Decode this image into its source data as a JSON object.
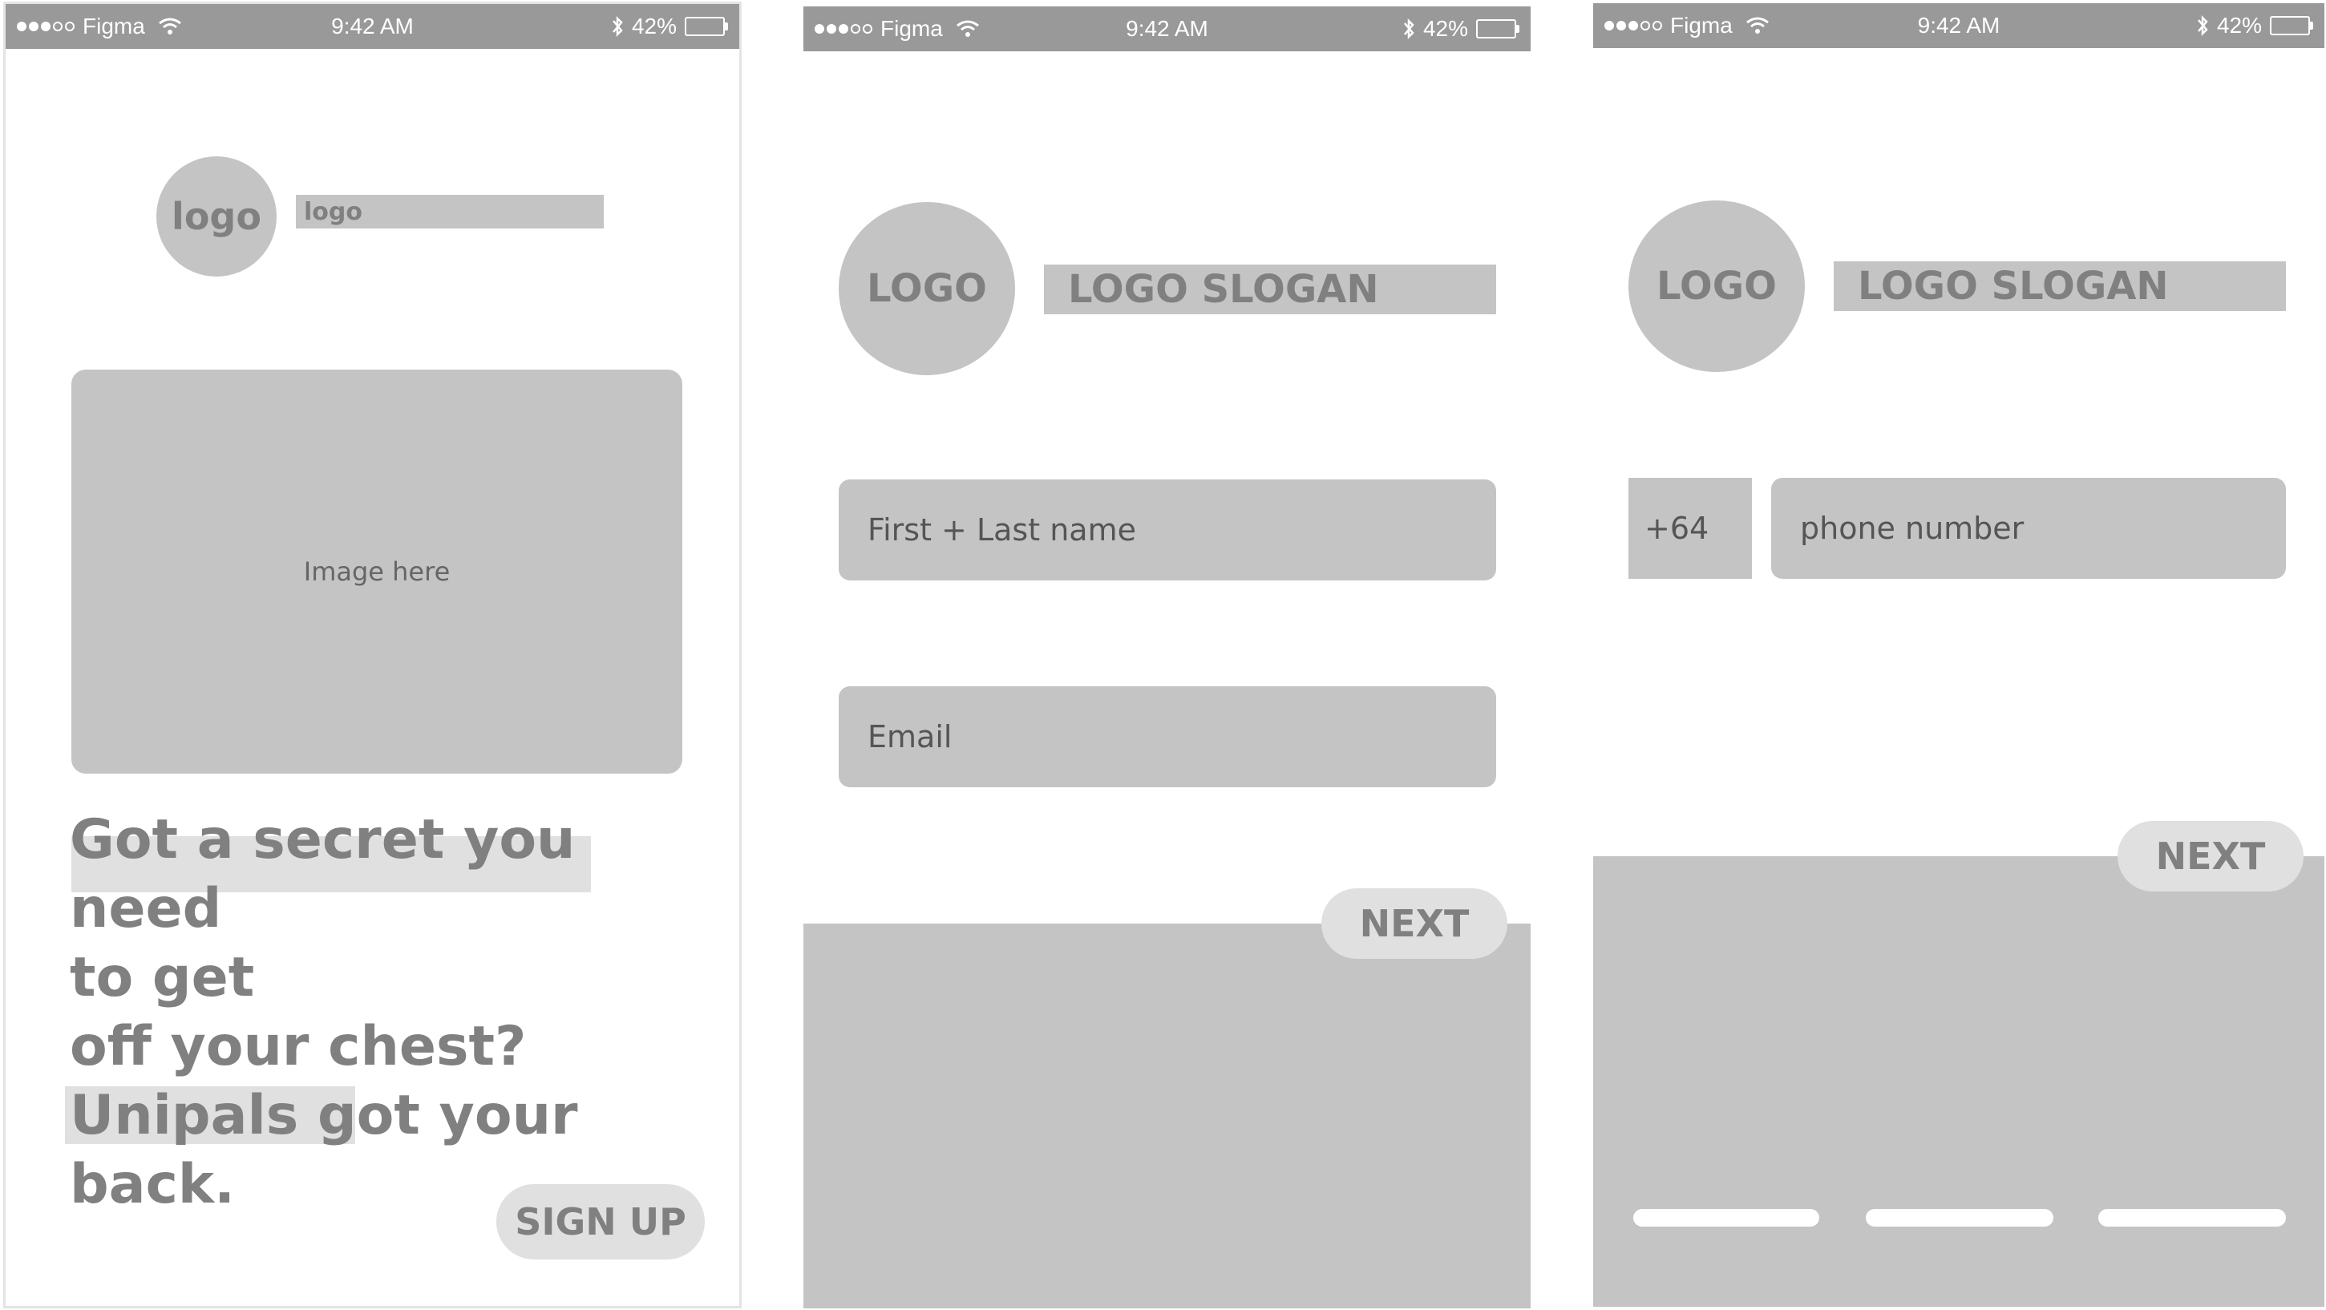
{
  "statusbar": {
    "carrier": "Figma",
    "time": "9:42 AM",
    "battery": "42%",
    "signal_bars_filled": 3,
    "signal_bars_total": 5
  },
  "screen1": {
    "logo_circle": "logo",
    "logo_text": "logo",
    "image_placeholder": "Image here",
    "headline_lines": [
      "Got a secret you need",
      "to get",
      "off your chest?",
      "Unipals got your",
      "back."
    ],
    "signup_button": "SIGN UP"
  },
  "screen2": {
    "logo_circle": "LOGO",
    "slogan": "LOGO SLOGAN",
    "name_placeholder": "First + Last name",
    "email_placeholder": "Email",
    "next_button": "NEXT"
  },
  "screen3": {
    "logo_circle": "LOGO",
    "slogan": "LOGO SLOGAN",
    "country_code": "+64",
    "phone_placeholder": "phone number",
    "next_button": "NEXT",
    "page_indicators": 3
  },
  "colors": {
    "statusbar": "#999999",
    "placeholder_fill": "#c4c4c4",
    "button_fill": "#e0e0e0",
    "text_gray": "#808080"
  },
  "icons": {
    "wifi": "wifi-icon",
    "bluetooth": "bluetooth-icon",
    "battery": "battery-icon",
    "signal": "signal-dots-icon"
  }
}
